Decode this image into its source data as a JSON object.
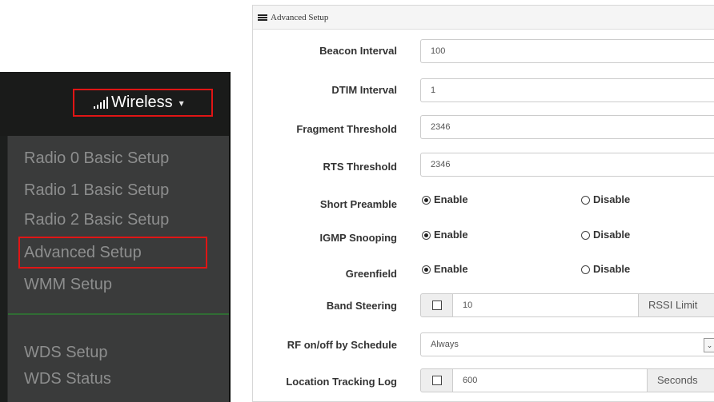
{
  "nav": {
    "wireless_label": "Wireless",
    "menu_items": [
      "Radio 0 Basic Setup",
      "Radio 1 Basic Setup",
      "Radio 2 Basic Setup",
      "Advanced Setup",
      "WMM Setup",
      "WDS Setup",
      "WDS Status"
    ],
    "highlight_color": "#e01515"
  },
  "panel": {
    "title": "Advanced Setup",
    "beacon_interval": {
      "label": "Beacon Interval",
      "value": "100"
    },
    "dtim_interval": {
      "label": "DTIM Interval",
      "value": "1"
    },
    "fragment_threshold": {
      "label": "Fragment Threshold",
      "value": "2346"
    },
    "rts_threshold": {
      "label": "RTS Threshold",
      "value": "2346"
    },
    "short_preamble": {
      "label": "Short Preamble",
      "enable": "Enable",
      "disable": "Disable",
      "selected": "Enable"
    },
    "igmp_snooping": {
      "label": "IGMP Snooping",
      "enable": "Enable",
      "disable": "Disable",
      "selected": "Enable"
    },
    "greenfield": {
      "label": "Greenfield",
      "enable": "Enable",
      "disable": "Disable",
      "selected": "Enable"
    },
    "band_steering": {
      "label": "Band Steering",
      "checked": false,
      "value": "10",
      "suffix": "RSSI Limit"
    },
    "rf_schedule": {
      "label": "RF on/off by Schedule",
      "selected": "Always"
    },
    "location_tracking": {
      "label": "Location Tracking Log",
      "checked": false,
      "value": "600",
      "suffix": "Seconds"
    }
  }
}
